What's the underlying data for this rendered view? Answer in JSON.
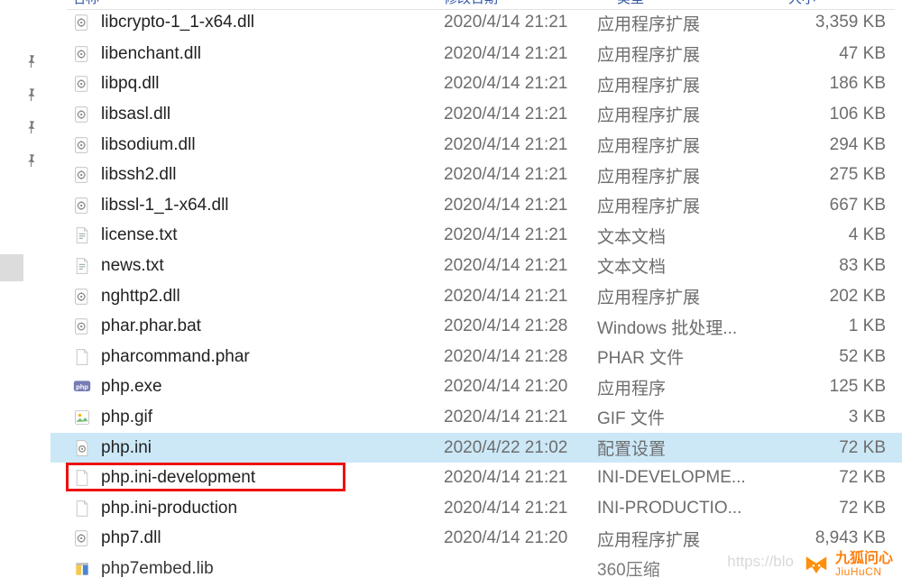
{
  "headers": {
    "name": "名称",
    "modified": "修改日期",
    "type": "类型",
    "size": "大小"
  },
  "files": [
    {
      "name": "libcrypto-1_1-x64.dll",
      "date": "2020/4/14 21:21",
      "type": "应用程序扩展",
      "size": "3,359 KB",
      "icon": "gear",
      "clipped": true
    },
    {
      "name": "libenchant.dll",
      "date": "2020/4/14 21:21",
      "type": "应用程序扩展",
      "size": "47 KB",
      "icon": "gear"
    },
    {
      "name": "libpq.dll",
      "date": "2020/4/14 21:21",
      "type": "应用程序扩展",
      "size": "186 KB",
      "icon": "gear"
    },
    {
      "name": "libsasl.dll",
      "date": "2020/4/14 21:21",
      "type": "应用程序扩展",
      "size": "106 KB",
      "icon": "gear"
    },
    {
      "name": "libsodium.dll",
      "date": "2020/4/14 21:21",
      "type": "应用程序扩展",
      "size": "294 KB",
      "icon": "gear"
    },
    {
      "name": "libssh2.dll",
      "date": "2020/4/14 21:21",
      "type": "应用程序扩展",
      "size": "275 KB",
      "icon": "gear"
    },
    {
      "name": "libssl-1_1-x64.dll",
      "date": "2020/4/14 21:21",
      "type": "应用程序扩展",
      "size": "667 KB",
      "icon": "gear"
    },
    {
      "name": "license.txt",
      "date": "2020/4/14 21:21",
      "type": "文本文档",
      "size": "4 KB",
      "icon": "txt"
    },
    {
      "name": "news.txt",
      "date": "2020/4/14 21:21",
      "type": "文本文档",
      "size": "83 KB",
      "icon": "txt"
    },
    {
      "name": "nghttp2.dll",
      "date": "2020/4/14 21:21",
      "type": "应用程序扩展",
      "size": "202 KB",
      "icon": "gear"
    },
    {
      "name": "phar.phar.bat",
      "date": "2020/4/14 21:28",
      "type": "Windows 批处理...",
      "size": "1 KB",
      "icon": "bat"
    },
    {
      "name": "pharcommand.phar",
      "date": "2020/4/14 21:28",
      "type": "PHAR 文件",
      "size": "52 KB",
      "icon": "blank"
    },
    {
      "name": "php.exe",
      "date": "2020/4/14 21:20",
      "type": "应用程序",
      "size": "125 KB",
      "icon": "php"
    },
    {
      "name": "php.gif",
      "date": "2020/4/14 21:21",
      "type": "GIF 文件",
      "size": "3 KB",
      "icon": "gif"
    },
    {
      "name": "php.ini",
      "date": "2020/4/22 21:02",
      "type": "配置设置",
      "size": "72 KB",
      "icon": "ini",
      "selected": true
    },
    {
      "name": "php.ini-development",
      "date": "2020/4/14 21:21",
      "type": "INI-DEVELOPME...",
      "size": "72 KB",
      "icon": "blank",
      "highlighted": true
    },
    {
      "name": "php.ini-production",
      "date": "2020/4/14 21:21",
      "type": "INI-PRODUCTIO...",
      "size": "72 KB",
      "icon": "blank"
    },
    {
      "name": "php7.dll",
      "date": "2020/4/14 21:20",
      "type": "应用程序扩展",
      "size": "8,943 KB",
      "icon": "gear"
    },
    {
      "name": "php7embed.lib",
      "date": "",
      "type": "360压缩",
      "size": "",
      "icon": "lib"
    }
  ],
  "watermark": {
    "cn": "九狐问心",
    "en": "JiuHuCN"
  },
  "faded_url": "https://blo"
}
